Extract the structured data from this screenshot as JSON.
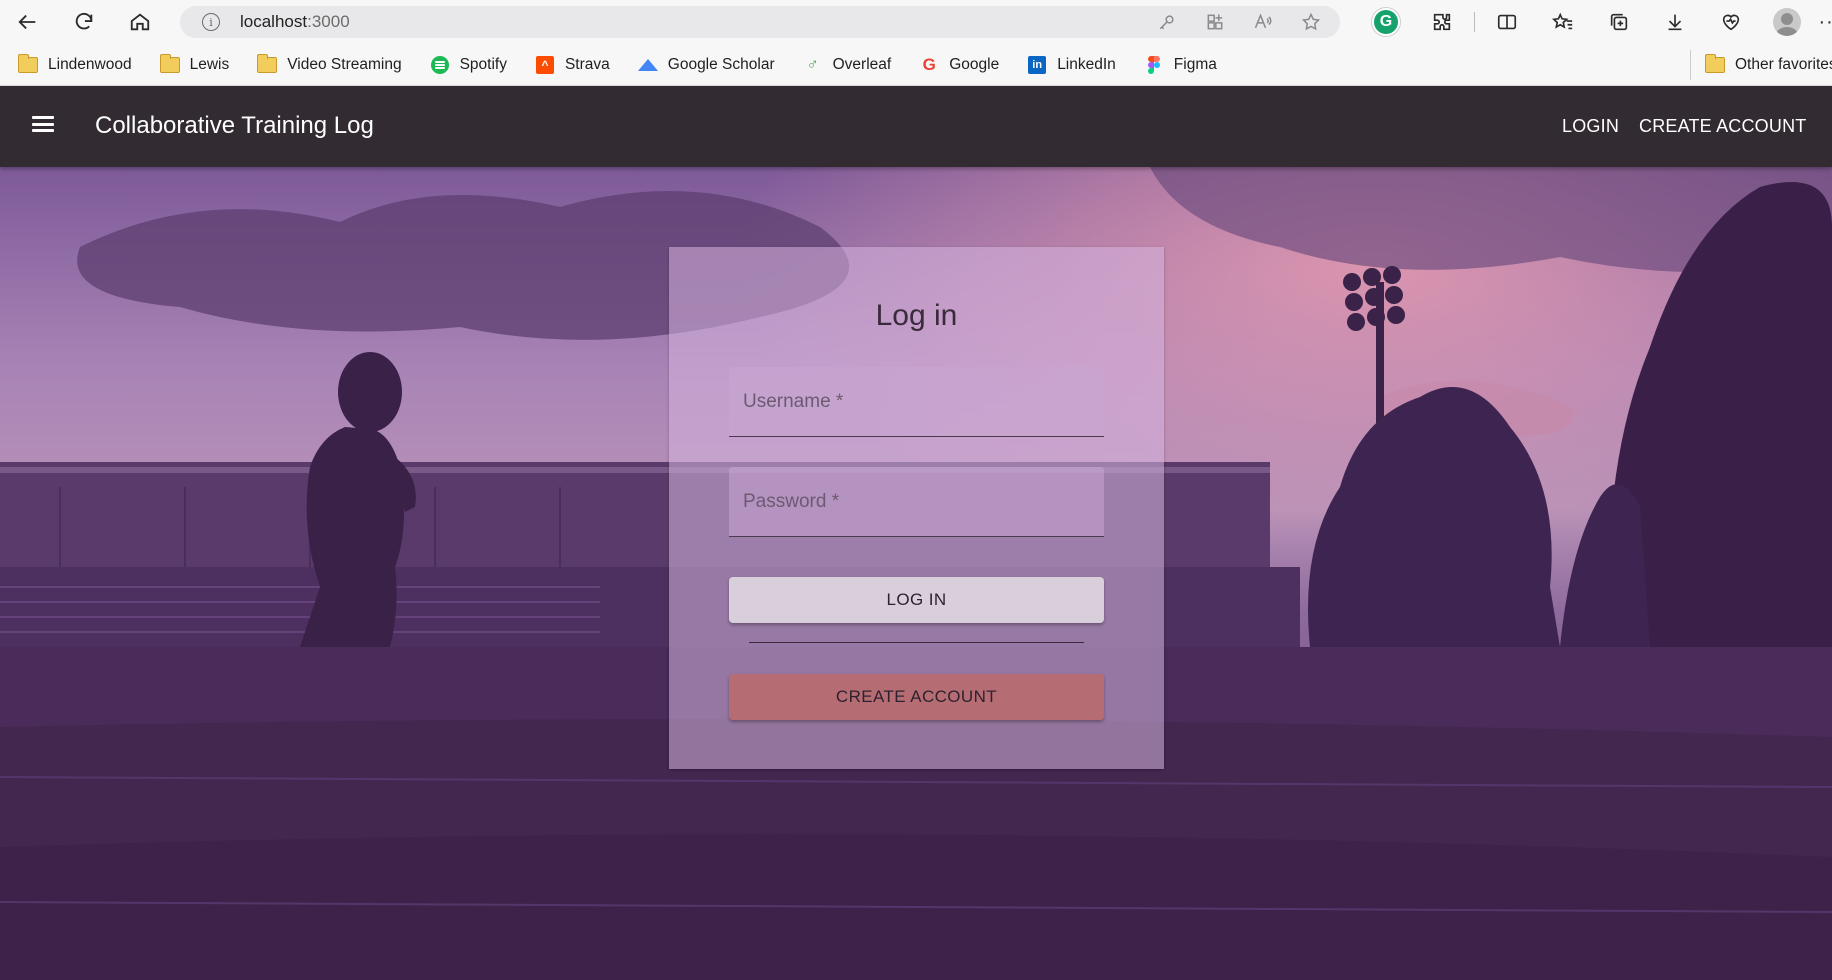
{
  "browser": {
    "url_host": "localhost",
    "url_port": ":3000",
    "icons": [
      "back-icon",
      "refresh-icon",
      "home-icon",
      "info-icon",
      "key-icon",
      "apps-icon",
      "read-aloud-icon",
      "favorite-star-icon",
      "grammarly-icon",
      "extensions-icon",
      "split-screen-icon",
      "favorites-icon",
      "collections-icon",
      "downloads-icon",
      "browser-essentials-icon",
      "profile-avatar-icon",
      "more-icon"
    ]
  },
  "bookmarks": {
    "items": [
      {
        "label": "Lindenwood",
        "icon": "folder-icon"
      },
      {
        "label": "Lewis",
        "icon": "folder-icon"
      },
      {
        "label": "Video Streaming",
        "icon": "folder-icon"
      },
      {
        "label": "Spotify",
        "icon": "spotify-icon"
      },
      {
        "label": "Strava",
        "icon": "strava-icon"
      },
      {
        "label": "Google Scholar",
        "icon": "google-scholar-icon"
      },
      {
        "label": "Overleaf",
        "icon": "overleaf-icon"
      },
      {
        "label": "Google",
        "icon": "google-icon"
      },
      {
        "label": "LinkedIn",
        "icon": "linkedin-icon"
      },
      {
        "label": "Figma",
        "icon": "figma-icon"
      }
    ],
    "other": "Other favorites"
  },
  "app_header": {
    "title": "Collaborative Training Log",
    "login_label": "LOGIN",
    "create_account_label": "CREATE ACCOUNT"
  },
  "login_card": {
    "title": "Log in",
    "username_placeholder": "Username *",
    "password_placeholder": "Password *",
    "login_button": "LOG IN",
    "create_account_button": "CREATE ACCOUNT"
  },
  "colors": {
    "app_header_bg": "#322b32",
    "create_button_bg": "#b66c73",
    "login_button_bg": "#d9cfdb",
    "hero_tint": "#5f3f6e"
  }
}
